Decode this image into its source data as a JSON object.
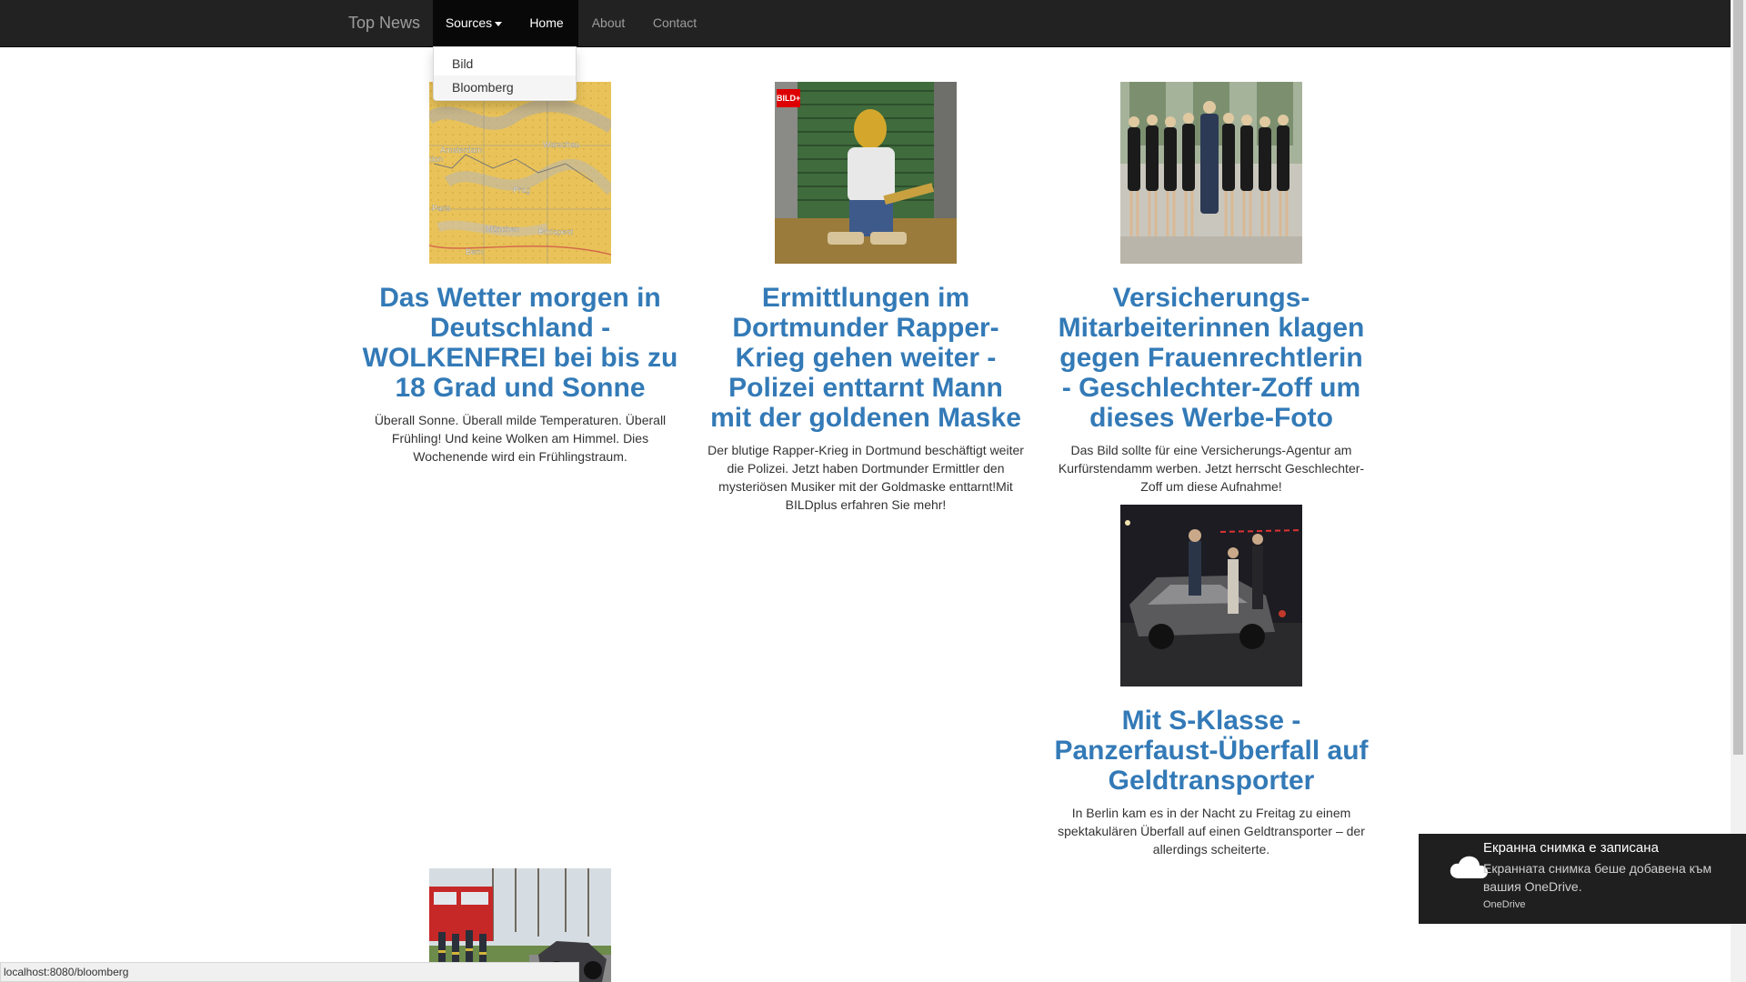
{
  "navbar": {
    "brand": "Top News",
    "sources_label": "Sources",
    "home_label": "Home",
    "about_label": "About",
    "contact_label": "Contact"
  },
  "dropdown": {
    "items": [
      {
        "label": "Bild"
      },
      {
        "label": "Bloomberg"
      }
    ]
  },
  "articles": [
    {
      "title": "Das Wetter morgen in Deutschland - WOLKENFREI bei bis zu 18 Grad und Sonne",
      "summary": "Überall Sonne. Überall milde Temperaturen. Überall Frühling! Und keine Wolken am Himmel. Dies Wochenende wird ein Frühlingstraum.",
      "image": "weather-map",
      "map_labels": [
        "Amsterdam",
        "Warschau",
        "don",
        "Prag",
        "Paris",
        "München",
        "Budapest",
        "Bern"
      ]
    },
    {
      "title": "Ermittlungen im Dortmunder Rapper-Krieg gehen weiter - Polizei enttarnt Mann mit der goldenen Maske",
      "summary": "Der blutige Rapper-Krieg in Dortmund beschäftigt weiter die Polizei. Jetzt haben Dortmunder Ermittler den mysteriösen Musiker mit der Goldmaske enttarnt!Mit BILDplus erfahren Sie mehr!",
      "image": "rapper-gold-mask",
      "badge": "BILD+"
    },
    {
      "title": "Versicherungs-Mitarbeiterinnen klagen gegen Frauenrechtlerin - Geschlechter-Zoff um dieses Werbe-Foto",
      "summary": "Das Bild sollte für eine Versicherungs-Agentur am Kurfürstendamm werben. Jetzt herrscht Geschlechter-Zoff um diese Aufnahme!",
      "image": "group-photo"
    },
    {
      "title": "Mit S-Klasse - Panzerfaust-Überfall auf Geldtransporter",
      "summary": "In Berlin kam es in der Nacht zu Freitag zu einem spektakulären Überfall auf einen Geldtransporter – der allerdings scheiterte.",
      "image": "burnt-car-night"
    },
    {
      "title": "",
      "summary": "",
      "image": "fire-truck-accident"
    }
  ],
  "statusbar": {
    "url": "localhost:8080/bloomberg"
  },
  "toast": {
    "title": "Екранна снимка е записана",
    "body": "Екранната снимка беше добавена към вашия OneDrive.",
    "app": "OneDrive",
    "icon": "cloud-icon"
  },
  "colors": {
    "navbar": "#222222",
    "link": "#337ab7",
    "toast": "#1f1f1f"
  }
}
